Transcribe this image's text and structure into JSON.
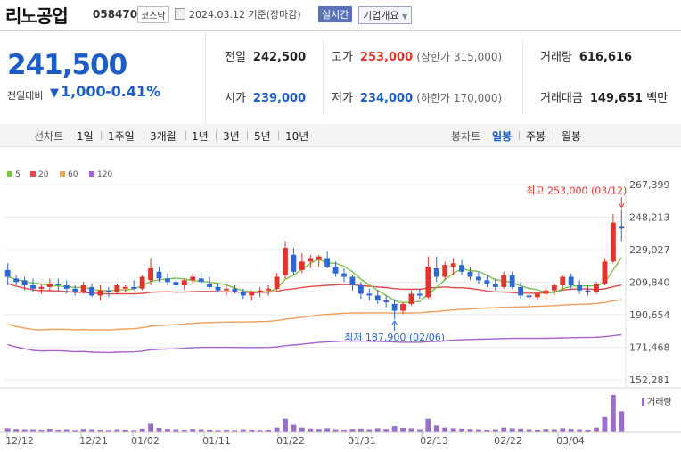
{
  "header": {
    "name": "리노공업",
    "code": "058470",
    "market": "코스닥",
    "date": "2024.03.12 기준(장마감)",
    "live_label": "실시간",
    "info_label": "기업개요"
  },
  "quote": {
    "price": "241,500",
    "diff_label": "전일대비",
    "diff_arrow": "▼",
    "diff": "1,000",
    "rate": "-0.41%",
    "prev_label": "전일",
    "prev": "242,500",
    "high_label": "고가",
    "high": "253,000",
    "upper": "(상한가 315,000)",
    "volume_label": "거래량",
    "volume": "616,616",
    "open_label": "시가",
    "open": "239,000",
    "low_label": "저가",
    "low": "234,000",
    "lower": "(하한가 170,000)",
    "amount_label": "거래대금",
    "amount": "149,651",
    "amount_unit": "백만"
  },
  "period_bar": {
    "line_label": "선차트",
    "line_items": [
      "1일",
      "1주일",
      "3개월",
      "1년",
      "3년",
      "5년",
      "10년"
    ],
    "candle_label": "봉차트",
    "candle_items": [
      "일봉",
      "주봉",
      "월봉"
    ],
    "selected": "일봉"
  },
  "colors": {
    "up": "#e0342c",
    "down": "#2f66d0",
    "ma5": "#7cc14a",
    "ma20": "#e04a4a",
    "ma60": "#f0a05a",
    "ma120": "#a463d0",
    "volume": "#9a6dc7"
  },
  "chart_data": {
    "type": "candlestick",
    "legend": [
      "5",
      "20",
      "60",
      "120"
    ],
    "y_ticks": [
      267399,
      248213,
      229027,
      209840,
      190654,
      171468,
      152281
    ],
    "ylim": [
      152281,
      267399
    ],
    "x_labels": [
      "12/12",
      "12/21",
      "01/02",
      "01/11",
      "01/22",
      "01/31",
      "02/13",
      "02/22",
      "03/04"
    ],
    "annotations": {
      "high": "최고 253,000 (03/12)",
      "low": "최저 187,900 (02/06)"
    },
    "volume_label": "거래량",
    "candles": [
      [
        217000,
        221000,
        208000,
        213000
      ],
      [
        212000,
        214000,
        208000,
        210000
      ],
      [
        211000,
        213000,
        205000,
        208000
      ],
      [
        208000,
        212000,
        204000,
        206000
      ],
      [
        206000,
        209000,
        203000,
        207000
      ],
      [
        207000,
        212000,
        205000,
        209000
      ],
      [
        209000,
        212000,
        205000,
        208000
      ],
      [
        208000,
        211000,
        203000,
        206000
      ],
      [
        206000,
        208000,
        202000,
        204000
      ],
      [
        204000,
        210000,
        203000,
        208000
      ],
      [
        207000,
        209000,
        201000,
        202000
      ],
      [
        202000,
        208000,
        199000,
        205000
      ],
      [
        205000,
        207000,
        201000,
        204000
      ],
      [
        204000,
        209000,
        203000,
        208000
      ],
      [
        206000,
        208000,
        204000,
        207000
      ],
      [
        207000,
        211000,
        205000,
        206000
      ],
      [
        206000,
        214000,
        205000,
        213000
      ],
      [
        211000,
        224000,
        208000,
        218000
      ],
      [
        216000,
        219000,
        210000,
        212000
      ],
      [
        212000,
        215000,
        208000,
        210000
      ],
      [
        210000,
        214000,
        206000,
        208000
      ],
      [
        208000,
        212000,
        205000,
        211000
      ],
      [
        211000,
        215000,
        209000,
        213000
      ],
      [
        212000,
        216000,
        208000,
        210000
      ],
      [
        209000,
        213000,
        206000,
        207000
      ],
      [
        207000,
        209000,
        204000,
        205000
      ],
      [
        205000,
        208000,
        202000,
        206000
      ],
      [
        206000,
        208000,
        203000,
        204000
      ],
      [
        204000,
        206000,
        200000,
        202000
      ],
      [
        202000,
        205000,
        199000,
        204000
      ],
      [
        204000,
        207000,
        201000,
        205000
      ],
      [
        205000,
        208000,
        202000,
        206000
      ],
      [
        206000,
        215000,
        205000,
        213000
      ],
      [
        214000,
        234000,
        212000,
        230000
      ],
      [
        226000,
        230000,
        214000,
        216000
      ],
      [
        217000,
        227000,
        215000,
        222000
      ],
      [
        222000,
        226000,
        218000,
        224000
      ],
      [
        223000,
        226000,
        219000,
        225000
      ],
      [
        224000,
        228000,
        218000,
        219000
      ],
      [
        219000,
        222000,
        213000,
        215000
      ],
      [
        215000,
        218000,
        210000,
        213000
      ],
      [
        213000,
        214000,
        205000,
        208000
      ],
      [
        208000,
        210000,
        200000,
        203000
      ],
      [
        203000,
        206000,
        199000,
        202000
      ],
      [
        202000,
        205000,
        197000,
        199000
      ],
      [
        199000,
        202000,
        195000,
        198000
      ],
      [
        197000,
        200000,
        187900,
        193000
      ],
      [
        193000,
        198000,
        191000,
        197000
      ],
      [
        197000,
        205000,
        196000,
        203000
      ],
      [
        203000,
        206000,
        200000,
        202000
      ],
      [
        201000,
        225000,
        200000,
        219000
      ],
      [
        218000,
        225000,
        210000,
        213000
      ],
      [
        213000,
        222000,
        211000,
        220000
      ],
      [
        219000,
        224000,
        214000,
        221000
      ],
      [
        220000,
        223000,
        214000,
        216000
      ],
      [
        216000,
        219000,
        211000,
        213000
      ],
      [
        213000,
        216000,
        209000,
        211000
      ],
      [
        211000,
        214000,
        207000,
        209000
      ],
      [
        209000,
        212000,
        205000,
        207000
      ],
      [
        207000,
        216000,
        206000,
        214000
      ],
      [
        214000,
        216000,
        206000,
        207000
      ],
      [
        207000,
        210000,
        200000,
        202000
      ],
      [
        202000,
        205000,
        199000,
        201000
      ],
      [
        201000,
        204000,
        199000,
        203000
      ],
      [
        203000,
        207000,
        200000,
        205000
      ],
      [
        205000,
        209000,
        202000,
        208000
      ],
      [
        208000,
        214000,
        206000,
        213000
      ],
      [
        213000,
        215000,
        206000,
        208000
      ],
      [
        208000,
        211000,
        203000,
        205000
      ],
      [
        205000,
        208000,
        202000,
        204000
      ],
      [
        204000,
        210000,
        203000,
        209000
      ],
      [
        209000,
        224000,
        208000,
        222000
      ],
      [
        222000,
        250000,
        221000,
        245000
      ],
      [
        242500,
        253000,
        234000,
        241500
      ]
    ],
    "volumes": [
      12,
      10,
      9,
      9,
      8,
      10,
      8,
      9,
      7,
      10,
      9,
      8,
      7,
      9,
      8,
      7,
      11,
      25,
      13,
      10,
      9,
      8,
      10,
      9,
      8,
      7,
      8,
      7,
      9,
      8,
      7,
      8,
      14,
      40,
      22,
      14,
      11,
      10,
      12,
      9,
      8,
      10,
      11,
      9,
      12,
      10,
      18,
      13,
      12,
      9,
      40,
      20,
      14,
      12,
      11,
      10,
      9,
      8,
      9,
      14,
      12,
      11,
      9,
      8,
      10,
      9,
      12,
      10,
      9,
      8,
      14,
      45,
      110,
      62
    ]
  }
}
